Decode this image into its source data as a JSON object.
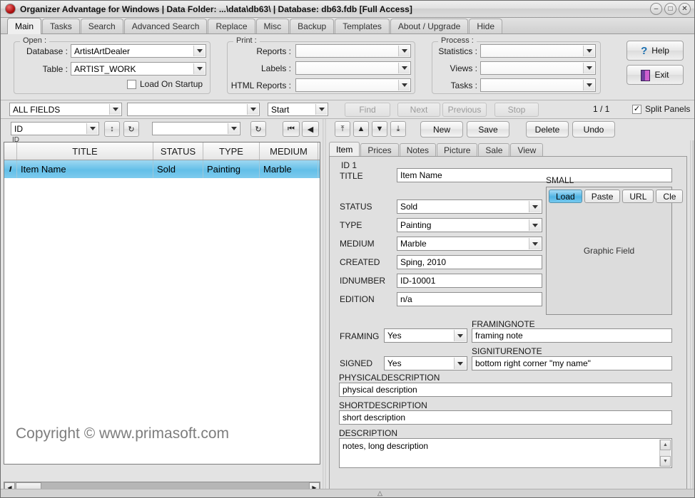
{
  "window": {
    "title": "Organizer Advantage for Windows | Data Folder: ...\\data\\db63\\ | Database: db63.fdb [Full Access]",
    "minimize": "–",
    "maximize": "□",
    "close": "✕"
  },
  "tabs": [
    {
      "label": "Main",
      "active": true
    },
    {
      "label": "Tasks",
      "active": false
    },
    {
      "label": "Search",
      "active": false
    },
    {
      "label": "Advanced Search",
      "active": false
    },
    {
      "label": "Replace",
      "active": false
    },
    {
      "label": "Misc",
      "active": false
    },
    {
      "label": "Backup",
      "active": false
    },
    {
      "label": "Templates",
      "active": false
    },
    {
      "label": "About / Upgrade",
      "active": false
    },
    {
      "label": "Hide",
      "active": false
    }
  ],
  "open_group": {
    "title": "Open :",
    "database_label": "Database :",
    "database_value": "ArtistArtDealer",
    "table_label": "Table :",
    "table_value": "ARTIST_WORK",
    "load_on_startup_label": "Load On Startup",
    "load_on_startup_checked": ""
  },
  "print_group": {
    "title": "Print :",
    "reports_label": "Reports :",
    "reports_value": "",
    "labels_label": "Labels :",
    "labels_value": "",
    "html_reports_label": "HTML Reports :",
    "html_reports_value": ""
  },
  "process_group": {
    "title": "Process :",
    "statistics_label": "Statistics :",
    "statistics_value": "",
    "views_label": "Views :",
    "views_value": "",
    "tasks_label": "Tasks :",
    "tasks_value": ""
  },
  "action_buttons": {
    "help": "Help",
    "exit": "Exit"
  },
  "searchbar": {
    "field_scope": "ALL FIELDS",
    "query": "",
    "match_mode": "Start",
    "find": "Find",
    "next": "Next",
    "previous": "Previous",
    "stop": "Stop",
    "page_counter": "1 / 1",
    "split_panels_label": "Split Panels",
    "split_panels_checked": "✓"
  },
  "left_nav": {
    "sort_field": "ID",
    "sort_field_sub": "ID",
    "sort_toggle_icon": "↕",
    "refresh_icon": "↻",
    "filter_value": "",
    "filter_refresh_icon": "↻",
    "first_icon": "⏮",
    "prev_icon": "◀"
  },
  "grid": {
    "columns": [
      "",
      "TITLE",
      "STATUS",
      "TYPE",
      "MEDIUM"
    ],
    "rows": [
      {
        "marker": "I",
        "TITLE": "Item Name",
        "STATUS": "Sold",
        "TYPE": "Painting",
        "MEDIUM": "Marble",
        "selected": true
      }
    ],
    "copyright": "Copyright ©   www.primasoft.com",
    "hscroll_left_icon": "◀",
    "hscroll_right_icon": "▶"
  },
  "record_toolbar": {
    "first_icon": "⤒",
    "up_icon": "▲",
    "down_icon": "▼",
    "last_icon": "⤓",
    "new": "New",
    "save": "Save",
    "delete": "Delete",
    "undo": "Undo"
  },
  "detail_tabs": [
    {
      "label": "Item",
      "active": true
    },
    {
      "label": "Prices",
      "active": false
    },
    {
      "label": "Notes",
      "active": false
    },
    {
      "label": "Picture",
      "active": false
    },
    {
      "label": "Sale",
      "active": false
    },
    {
      "label": "View",
      "active": false
    }
  ],
  "form": {
    "id_label": "ID  1",
    "title_label": "TITLE",
    "title_value": "Item Name",
    "status_label": "STATUS",
    "status_value": "Sold",
    "type_label": "TYPE",
    "type_value": "Painting",
    "medium_label": "MEDIUM",
    "medium_value": "Marble",
    "created_label": "CREATED",
    "created_value": "Sping, 2010",
    "idnumber_label": "IDNUMBER",
    "idnumber_value": "ID-10001",
    "edition_label": "EDITION",
    "edition_value": "n/a",
    "small_label": "SMALL",
    "graphic_buttons": [
      {
        "label": "Load",
        "active": true
      },
      {
        "label": "Paste",
        "active": false
      },
      {
        "label": "URL",
        "active": false
      },
      {
        "label": "Cle",
        "active": false
      }
    ],
    "graphic_placeholder": "Graphic Field",
    "framing_label": "FRAMING",
    "framing_value": "Yes",
    "framingnote_label": "FRAMINGNOTE",
    "framingnote_value": "framing note",
    "signed_label": "SIGNED",
    "signed_value": "Yes",
    "signiturenote_label": "SIGNITURENOTE",
    "signiturenote_value": "bottom right corner \"my name\"",
    "physicaldescription_label": "PHYSICALDESCRIPTION",
    "physicaldescription_value": "physical description",
    "shortdescription_label": "SHORTDESCRIPTION",
    "shortdescription_value": "short description",
    "description_label": "DESCRIPTION",
    "description_value": "notes, long description",
    "desc_scroll_up": "▲",
    "desc_scroll_down": "▼"
  },
  "statusbar": {
    "grip": "△"
  }
}
